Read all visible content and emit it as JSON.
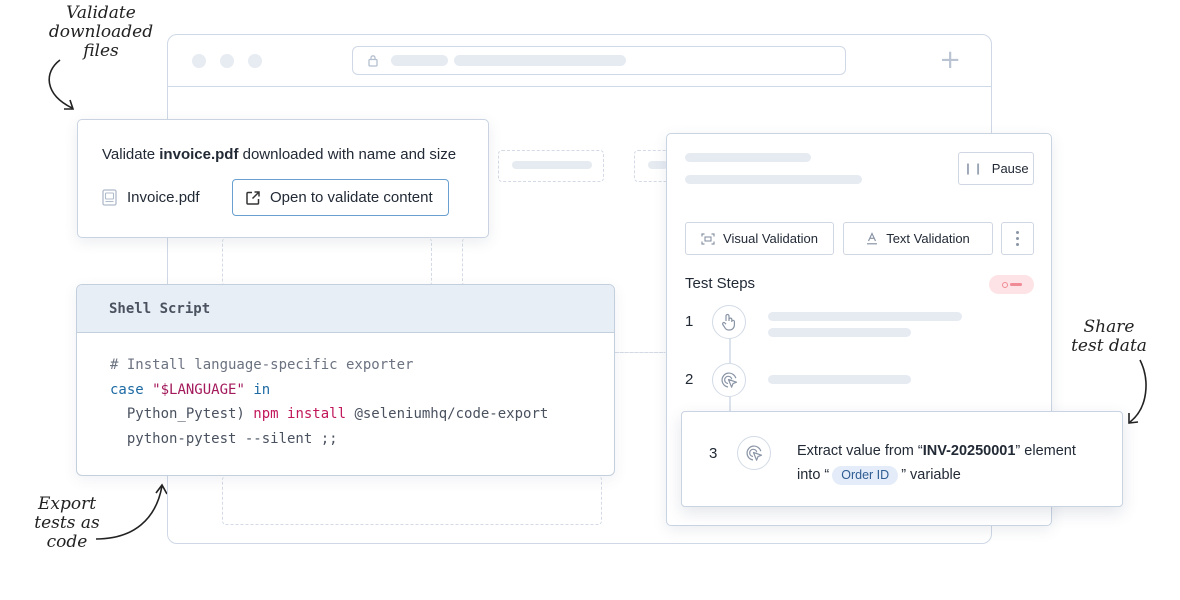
{
  "annotations": {
    "validate_files": [
      "Validate",
      "downloaded",
      "files"
    ],
    "export_tests": [
      "Export",
      "tests as",
      "code"
    ],
    "share_data": [
      "Share",
      "test data"
    ]
  },
  "browser": {
    "plus_glyph": "+"
  },
  "invoice_card": {
    "title_prefix": "Validate ",
    "title_bold": "invoice.pdf",
    "title_suffix": " downloaded with name and size",
    "file_name": "Invoice.pdf",
    "open_button_label": "Open to validate content"
  },
  "shell_card": {
    "header": "Shell Script",
    "code": {
      "line1_comment": "# Install language-specific exporter",
      "line2_kw": "case",
      "line2_str": "\"$LANGUAGE\"",
      "line2_kw2": "in",
      "line3_pre": "  Python_Pytest) ",
      "line3_cmd": "npm install",
      "line3_post": " @seleniumhq/code-export",
      "line4": "  python-pytest --silent ;;"
    }
  },
  "test_panel": {
    "pause_label": "Pause",
    "visual_validation_label": "Visual Validation",
    "text_validation_label": "Text Validation",
    "steps_title": "Test Steps",
    "steps": [
      {
        "number": "1",
        "icon": "tap-icon"
      },
      {
        "number": "2",
        "icon": "extract-icon"
      }
    ]
  },
  "step3_card": {
    "number": "3",
    "text_prefix": "Extract value from “",
    "text_bold": "INV-20250001",
    "text_mid": "” element",
    "text_into": "into “",
    "chip_label": "Order ID",
    "text_suffix": "” variable"
  }
}
